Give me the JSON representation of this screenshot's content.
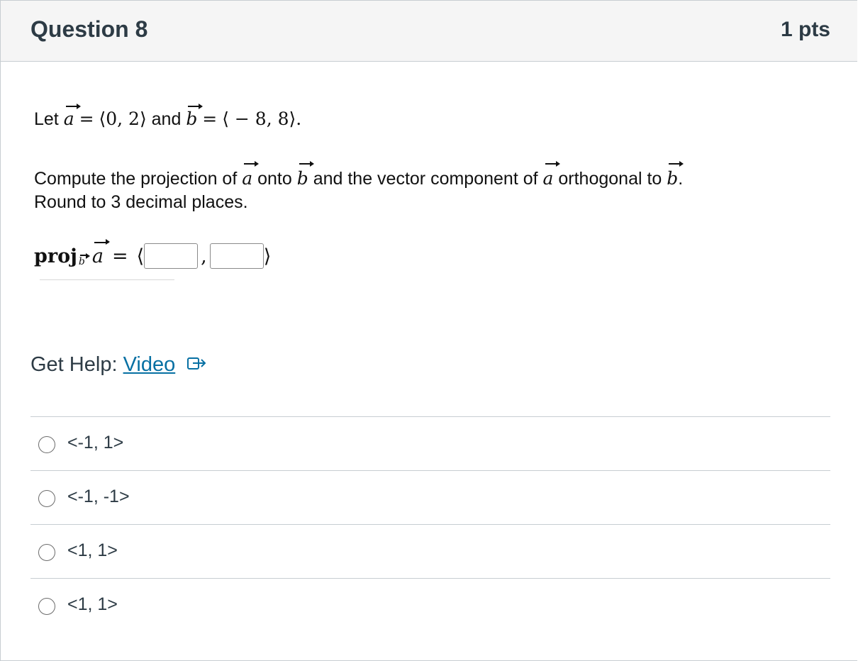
{
  "question": {
    "title": "Question 8",
    "points": "1 pts"
  },
  "problem": {
    "let_word": "Let",
    "a_symbol": "a",
    "equals": "=",
    "a_value": "⟨0, 2⟩",
    "and_word": "and",
    "b_symbol": "b",
    "b_value": "⟨ − 8, 8⟩.",
    "compute_text_1": "Compute the projection of",
    "compute_text_2": "onto",
    "compute_text_3": "and the vector component of",
    "compute_text_4": "orthogonal to",
    "compute_end": ".",
    "round_text": "Round to 3 decimal places."
  },
  "projection": {
    "proj_label": "proj",
    "open_bracket": "⟨",
    "separator": ",",
    "close_bracket": "⟩",
    "input_1_value": "",
    "input_2_value": ""
  },
  "help": {
    "prefix": "Get Help:",
    "link_text": "Video",
    "icon": "external-link-icon"
  },
  "options": [
    {
      "label": "<-1, 1>"
    },
    {
      "label": "<-1, -1>"
    },
    {
      "label": "<1, 1>"
    },
    {
      "label": "<1, 1>"
    }
  ],
  "colors": {
    "link": "#0770a3",
    "header_bg": "#f5f5f5",
    "border": "#c7cdd1",
    "text": "#2d3b45"
  }
}
